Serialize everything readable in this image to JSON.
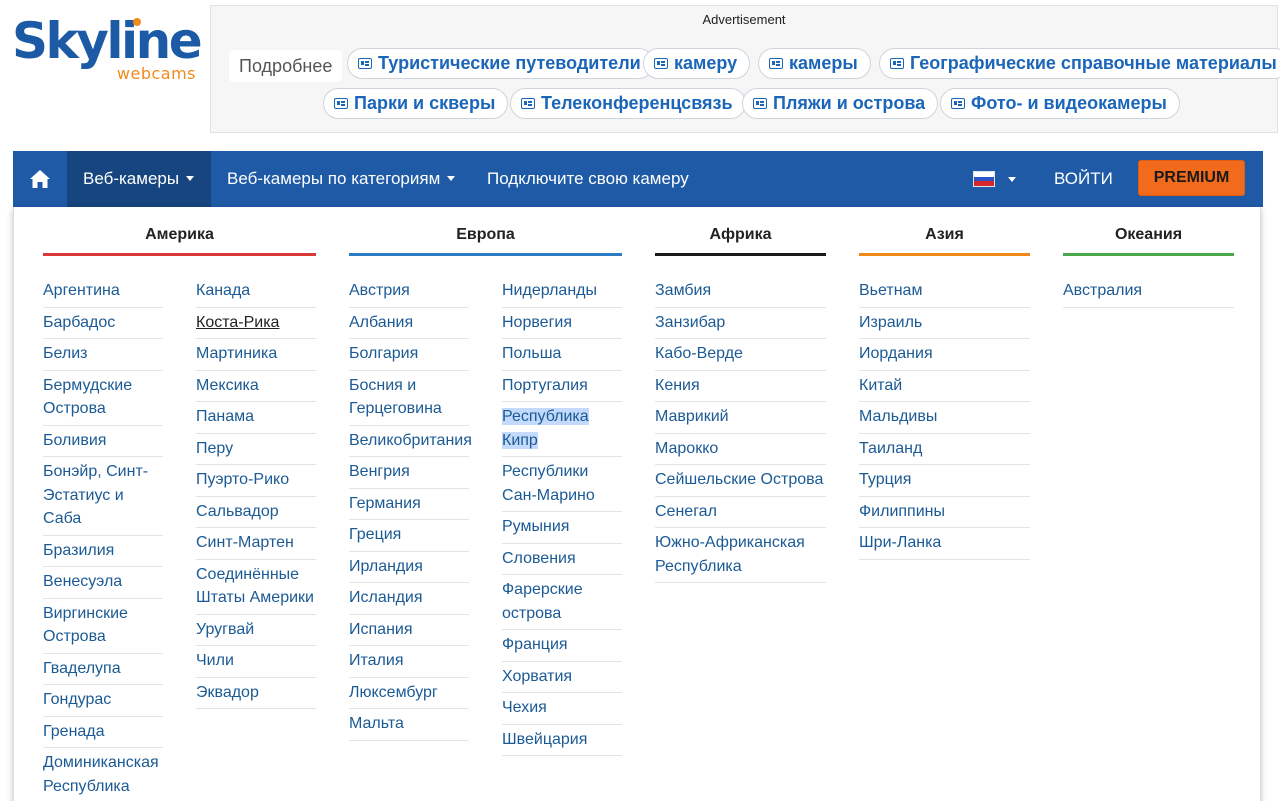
{
  "logo": {
    "main": "Skyline",
    "sub": "webcams"
  },
  "ad": {
    "label": "Advertisement",
    "more": "Подробнее",
    "chips": [
      "Туристические путеводители",
      "камеру",
      "камеры",
      "Географические справочные материалы",
      "Парки и скверы",
      "Телеконференцсвязь",
      "Пляжи и острова",
      "Фото- и видеокамеры"
    ]
  },
  "nav": {
    "webcams": "Веб-камеры",
    "categories": "Веб-камеры по категориям",
    "connect": "Подключите свою камеру",
    "login": "ВОЙТИ",
    "premium": "PREMIUM",
    "flag_colors": [
      "#ffffff",
      "#2a54c8",
      "#d8262e"
    ]
  },
  "regions": [
    {
      "title": "Америка",
      "color": "#d93a35",
      "columns": [
        [
          "Аргентина",
          "Барбадос",
          "Белиз",
          "Бермудские Острова",
          "Боливия",
          "Бонэйр, Синт-Эстатиус и Саба",
          "Бразилия",
          "Венесуэла",
          "Виргинские Острова",
          "Гваделупа",
          "Гондурас",
          "Гренада",
          "Доминиканская Республика"
        ],
        [
          "Канада",
          "Коста-Рика",
          "Мартиника",
          "Мексика",
          "Панама",
          "Перу",
          "Пуэрто-Рико",
          "Сальвадор",
          "Синт-Мартен",
          "Соединённые Штаты Америки",
          "Уругвай",
          "Чили",
          "Эквадор"
        ]
      ]
    },
    {
      "title": "Европа",
      "color": "#2b7bc4",
      "columns": [
        [
          "Австрия",
          "Албания",
          "Болгария",
          "Босния и Герцеговина",
          "Великобритания",
          "Венгрия",
          "Германия",
          "Греция",
          "Ирландия",
          "Исландия",
          "Испания",
          "Италия",
          "Люксембург",
          "Мальта"
        ],
        [
          "Нидерланды",
          "Норвегия",
          "Польша",
          "Португалия",
          "Республика Кипр",
          "Республики Сан-Марино",
          "Румыния",
          "Словения",
          "Фарерские острова",
          "Франция",
          "Хорватия",
          "Чехия",
          "Швейцария"
        ]
      ]
    },
    {
      "title": "Африка",
      "color": "#1a1a1a",
      "columns": [
        [
          "Замбия",
          "Занзибар",
          "Кабо-Верде",
          "Кения",
          "Маврикий",
          "Марокко",
          "Сейшельские Острова",
          "Сенегал",
          "Южно-Африканская Республика"
        ]
      ]
    },
    {
      "title": "Азия",
      "color": "#f08a1c",
      "columns": [
        [
          "Вьетнам",
          "Израиль",
          "Иордания",
          "Китай",
          "Мальдивы",
          "Таиланд",
          "Турция",
          "Филиппины",
          "Шри-Ланка"
        ]
      ]
    },
    {
      "title": "Океания",
      "color": "#4ca64c",
      "columns": [
        [
          "Австралия"
        ]
      ]
    }
  ]
}
